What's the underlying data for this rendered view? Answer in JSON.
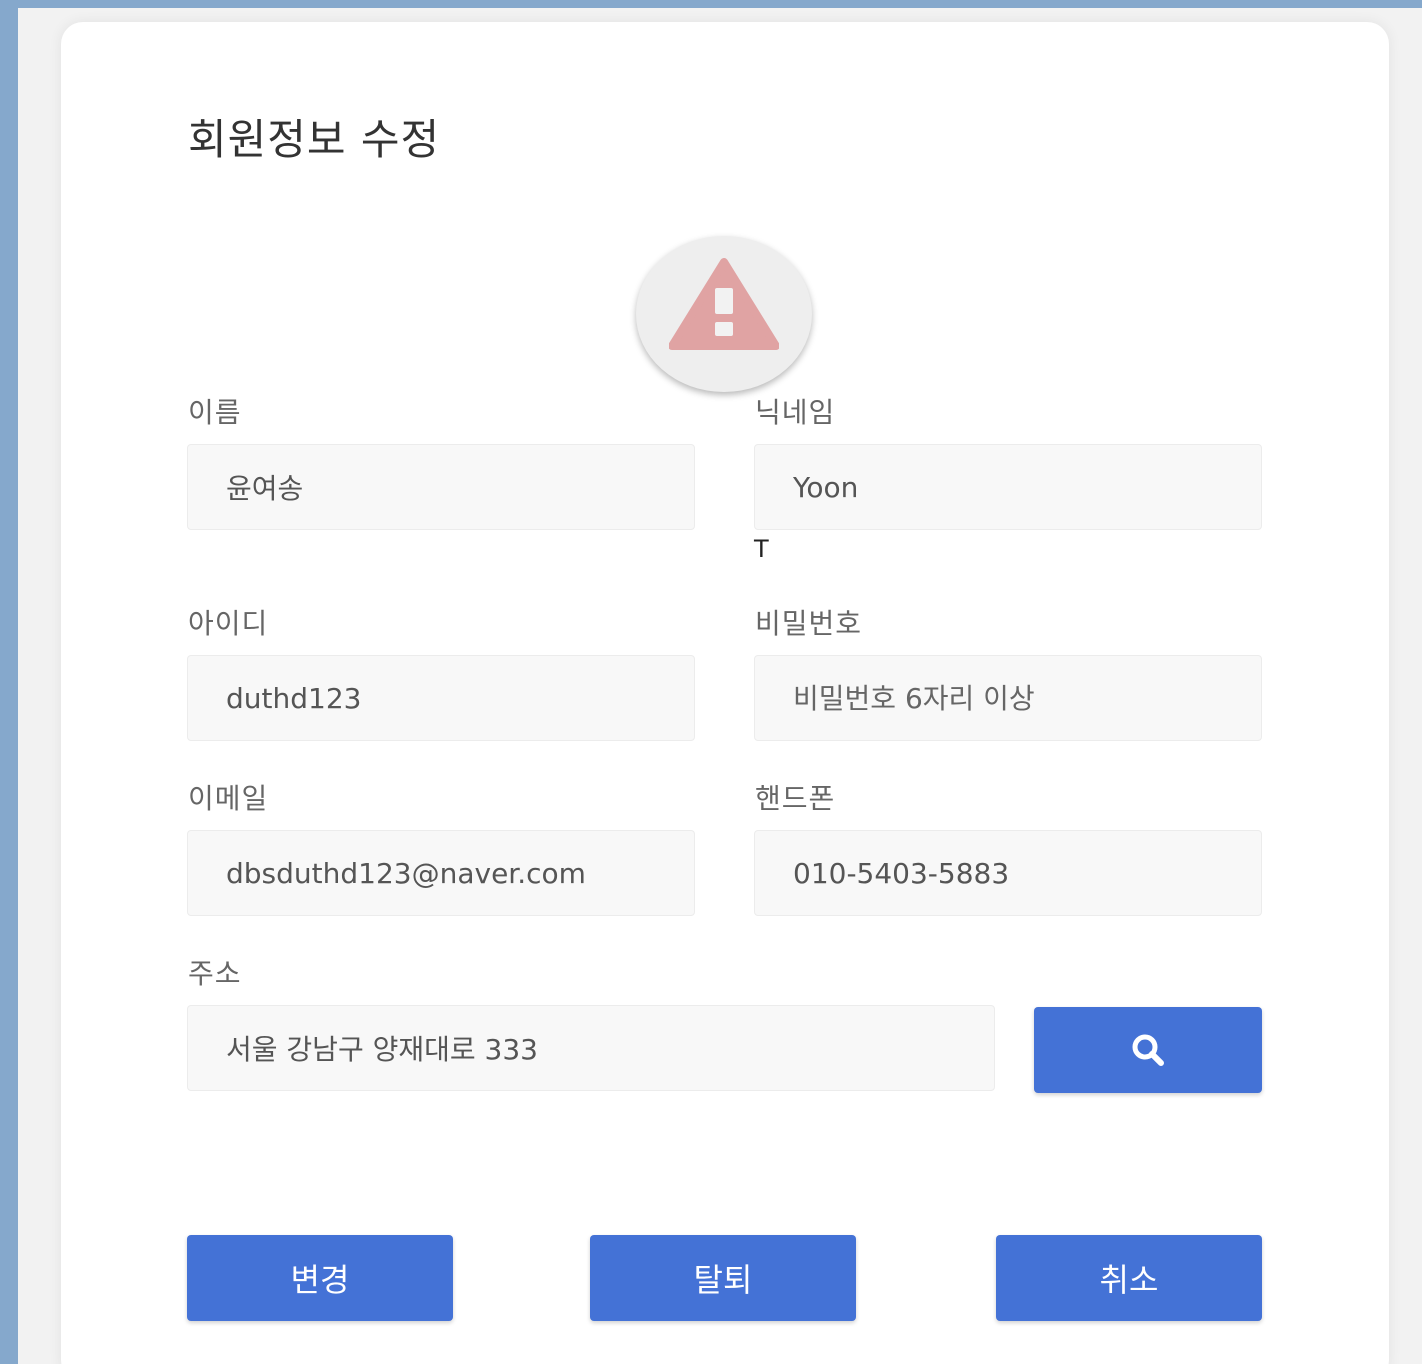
{
  "page": {
    "title": "회원정보 수정"
  },
  "form": {
    "name": {
      "label": "이름",
      "value": "윤여송"
    },
    "nickname": {
      "label": "닉네임",
      "value": "Yoon"
    },
    "nickname_cursor": "T",
    "user_id": {
      "label": "아이디",
      "value": "duthd123"
    },
    "password": {
      "label": "비밀번호",
      "placeholder": "비밀번호 6자리 이상"
    },
    "email": {
      "label": "이메일",
      "value": "dbsduthd123@naver.com"
    },
    "phone": {
      "label": "핸드폰",
      "value": "010-5403-5883"
    },
    "address": {
      "label": "주소",
      "value": "서울 강남구 양재대로 333"
    }
  },
  "buttons": {
    "address_search_icon": "search-icon",
    "change": "변경",
    "withdraw": "탈퇴",
    "cancel": "취소"
  },
  "icons": {
    "alert": "warning-icon"
  },
  "colors": {
    "background": "#85a8cc",
    "accent": "#4472d6",
    "warning": "#e0a3a3"
  }
}
